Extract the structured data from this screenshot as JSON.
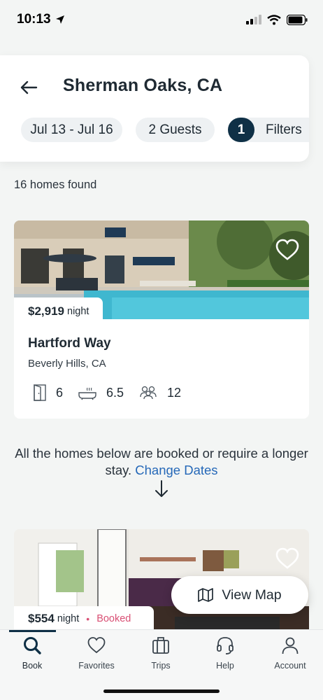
{
  "status_bar": {
    "time": "10:13"
  },
  "header": {
    "title": "Sherman Oaks, CA",
    "dates_chip": "Jul 13 - Jul 16",
    "guests_chip": "2 Guests",
    "filters_count": "1",
    "filters_label": "Filters"
  },
  "results": {
    "count_text": "16 homes found"
  },
  "listings": [
    {
      "price": "$2,919",
      "per": "night",
      "name": "Hartford Way",
      "city": "Beverly Hills, CA",
      "bedrooms": "6",
      "bathrooms": "6.5",
      "guests": "12"
    },
    {
      "price": "$554",
      "per": "night",
      "status": "Booked"
    }
  ],
  "notice": {
    "text": "All the homes below are booked or require a longer stay.",
    "link": "Change Dates"
  },
  "view_map_label": "View Map",
  "tabs": [
    {
      "label": "Book",
      "icon": "search-icon"
    },
    {
      "label": "Favorites",
      "icon": "heart-icon"
    },
    {
      "label": "Trips",
      "icon": "suitcase-icon"
    },
    {
      "label": "Help",
      "icon": "headset-icon"
    },
    {
      "label": "Account",
      "icon": "person-icon"
    }
  ],
  "colors": {
    "accent": "#0f3046",
    "link": "#2568b8",
    "booked": "#d95075",
    "background": "#f3f5f4"
  }
}
